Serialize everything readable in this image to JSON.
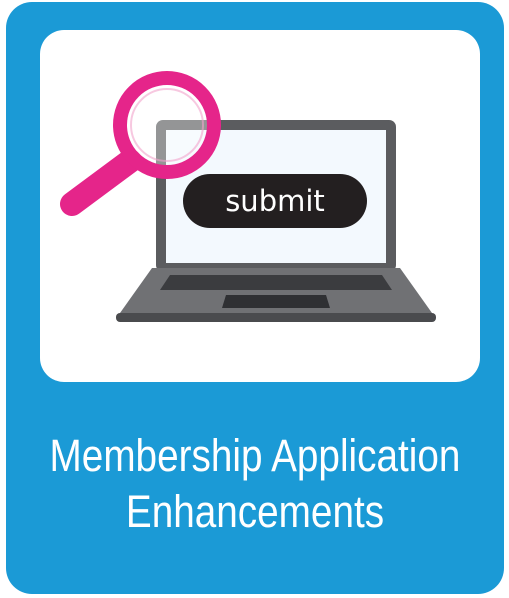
{
  "tile": {
    "title_line_1": "Membership Application",
    "title_line_2": "Enhancements"
  },
  "illustration": {
    "button_label": "submit",
    "icons": [
      "laptop-icon",
      "magnifying-glass-icon"
    ]
  },
  "colors": {
    "tile_background": "#1b9ad6",
    "panel_background": "#ffffff",
    "magnifier": "#e5258a",
    "laptop_body": "#5a5b5e",
    "submit_button": "#231f20"
  }
}
